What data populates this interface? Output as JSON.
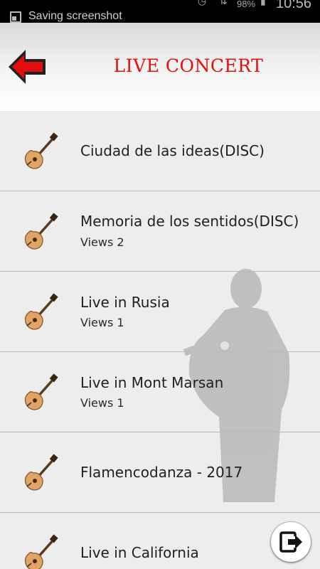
{
  "status_bar": {
    "notification_text": "Saving screenshot",
    "battery": "98%",
    "time": "10:56"
  },
  "header": {
    "title": "LIVE CONCERT",
    "title_color": "#e4100d"
  },
  "concerts": [
    {
      "title": "Ciudad de las ideas(DISC)",
      "views": ""
    },
    {
      "title": "Memoria de los sentidos(DISC)",
      "views": "Views 2"
    },
    {
      "title": "Live in Rusia",
      "views": "Views 1"
    },
    {
      "title": "Live in Mont Marsan",
      "views": "Views 1"
    },
    {
      "title": "Flamencodanza - 2017",
      "views": ""
    },
    {
      "title": "Live in California",
      "views": ""
    }
  ],
  "icons": {
    "back": "back-arrow-icon",
    "row": "guitar-icon",
    "exit": "exit-icon"
  }
}
